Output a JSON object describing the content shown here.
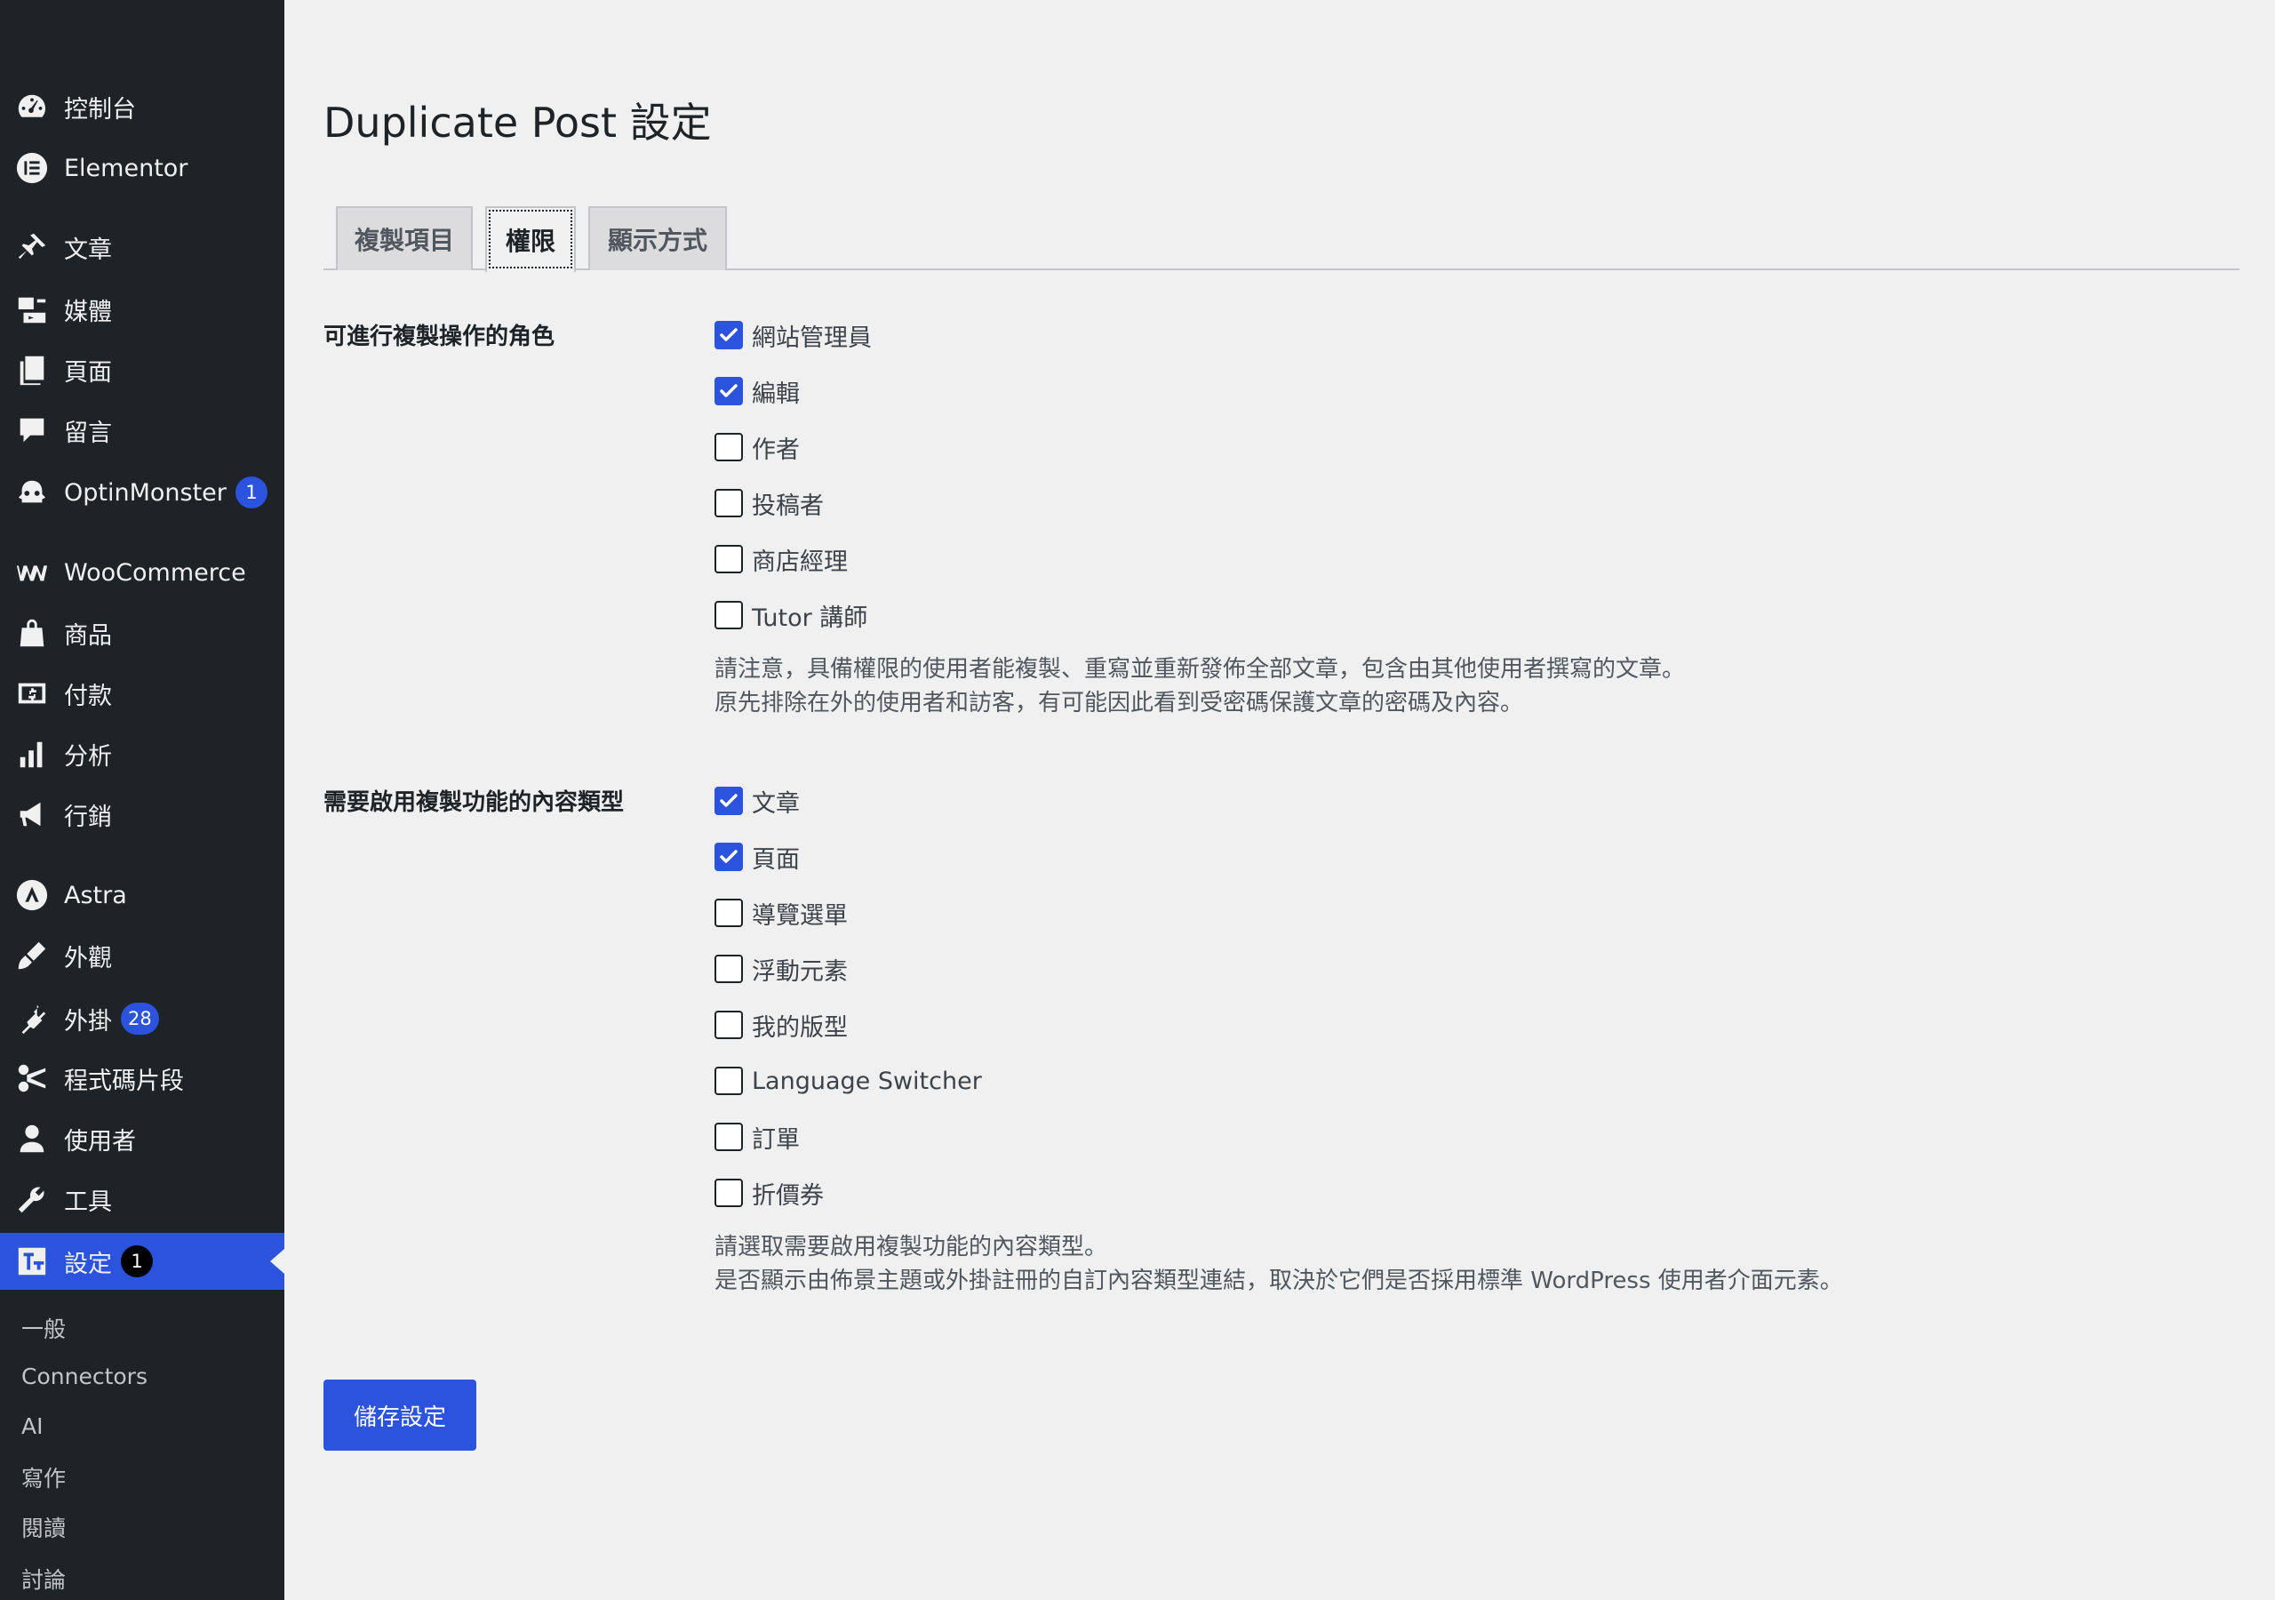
{
  "sidebar": {
    "items": [
      {
        "label": "控制台",
        "icon": "dashboard-icon"
      },
      {
        "label": "Elementor",
        "icon": "elementor-icon"
      },
      {
        "label": "文章",
        "icon": "pin-icon"
      },
      {
        "label": "媒體",
        "icon": "media-icon"
      },
      {
        "label": "頁面",
        "icon": "pages-icon"
      },
      {
        "label": "留言",
        "icon": "comment-icon"
      },
      {
        "label": "OptinMonster",
        "icon": "optinmonster-icon",
        "badge": "1"
      },
      {
        "label": "WooCommerce",
        "icon": "woocommerce-icon"
      },
      {
        "label": "商品",
        "icon": "products-icon"
      },
      {
        "label": "付款",
        "icon": "payments-icon"
      },
      {
        "label": "分析",
        "icon": "analytics-icon"
      },
      {
        "label": "行銷",
        "icon": "megaphone-icon"
      },
      {
        "label": "Astra",
        "icon": "astra-icon"
      },
      {
        "label": "外觀",
        "icon": "brush-icon"
      },
      {
        "label": "外掛",
        "icon": "plugin-icon",
        "badge": "28"
      },
      {
        "label": "程式碼片段",
        "icon": "scissors-icon"
      },
      {
        "label": "使用者",
        "icon": "user-icon"
      },
      {
        "label": "工具",
        "icon": "wrench-icon"
      },
      {
        "label": "設定",
        "icon": "settings-icon",
        "badge": "1"
      }
    ],
    "submenu": [
      "一般",
      "Connectors",
      "AI",
      "寫作",
      "閱讀",
      "討論"
    ]
  },
  "page": {
    "title": "Duplicate Post 設定",
    "tabs": [
      "複製項目",
      "權限",
      "顯示方式"
    ],
    "active_tab": "權限"
  },
  "roles": {
    "label": "可進行複製操作的角色",
    "options": [
      {
        "label": "網站管理員",
        "checked": true
      },
      {
        "label": "編輯",
        "checked": true
      },
      {
        "label": "作者",
        "checked": false
      },
      {
        "label": "投稿者",
        "checked": false
      },
      {
        "label": "商店經理",
        "checked": false
      },
      {
        "label": "Tutor 講師",
        "checked": false
      }
    ],
    "desc_line1": "請注意，具備權限的使用者能複製、重寫並重新發佈全部文章，包含由其他使用者撰寫的文章。",
    "desc_line2": "原先排除在外的使用者和訪客，有可能因此看到受密碼保護文章的密碼及內容。"
  },
  "post_types": {
    "label": "需要啟用複製功能的內容類型",
    "options": [
      {
        "label": "文章",
        "checked": true
      },
      {
        "label": "頁面",
        "checked": true
      },
      {
        "label": "導覽選單",
        "checked": false
      },
      {
        "label": "浮動元素",
        "checked": false
      },
      {
        "label": "我的版型",
        "checked": false
      },
      {
        "label": "Language Switcher",
        "checked": false
      },
      {
        "label": "訂單",
        "checked": false
      },
      {
        "label": "折價券",
        "checked": false
      }
    ],
    "desc_line1": "請選取需要啟用複製功能的內容類型。",
    "desc_line2": "是否顯示由佈景主題或外掛註冊的自訂內容類型連結，取決於它們是否採用標準 WordPress 使用者介面元素。"
  },
  "save_label": "儲存設定",
  "colors": {
    "accent": "#2b53dd",
    "sidebar_bg": "#1d2327",
    "page_bg": "#f0f0f1"
  }
}
